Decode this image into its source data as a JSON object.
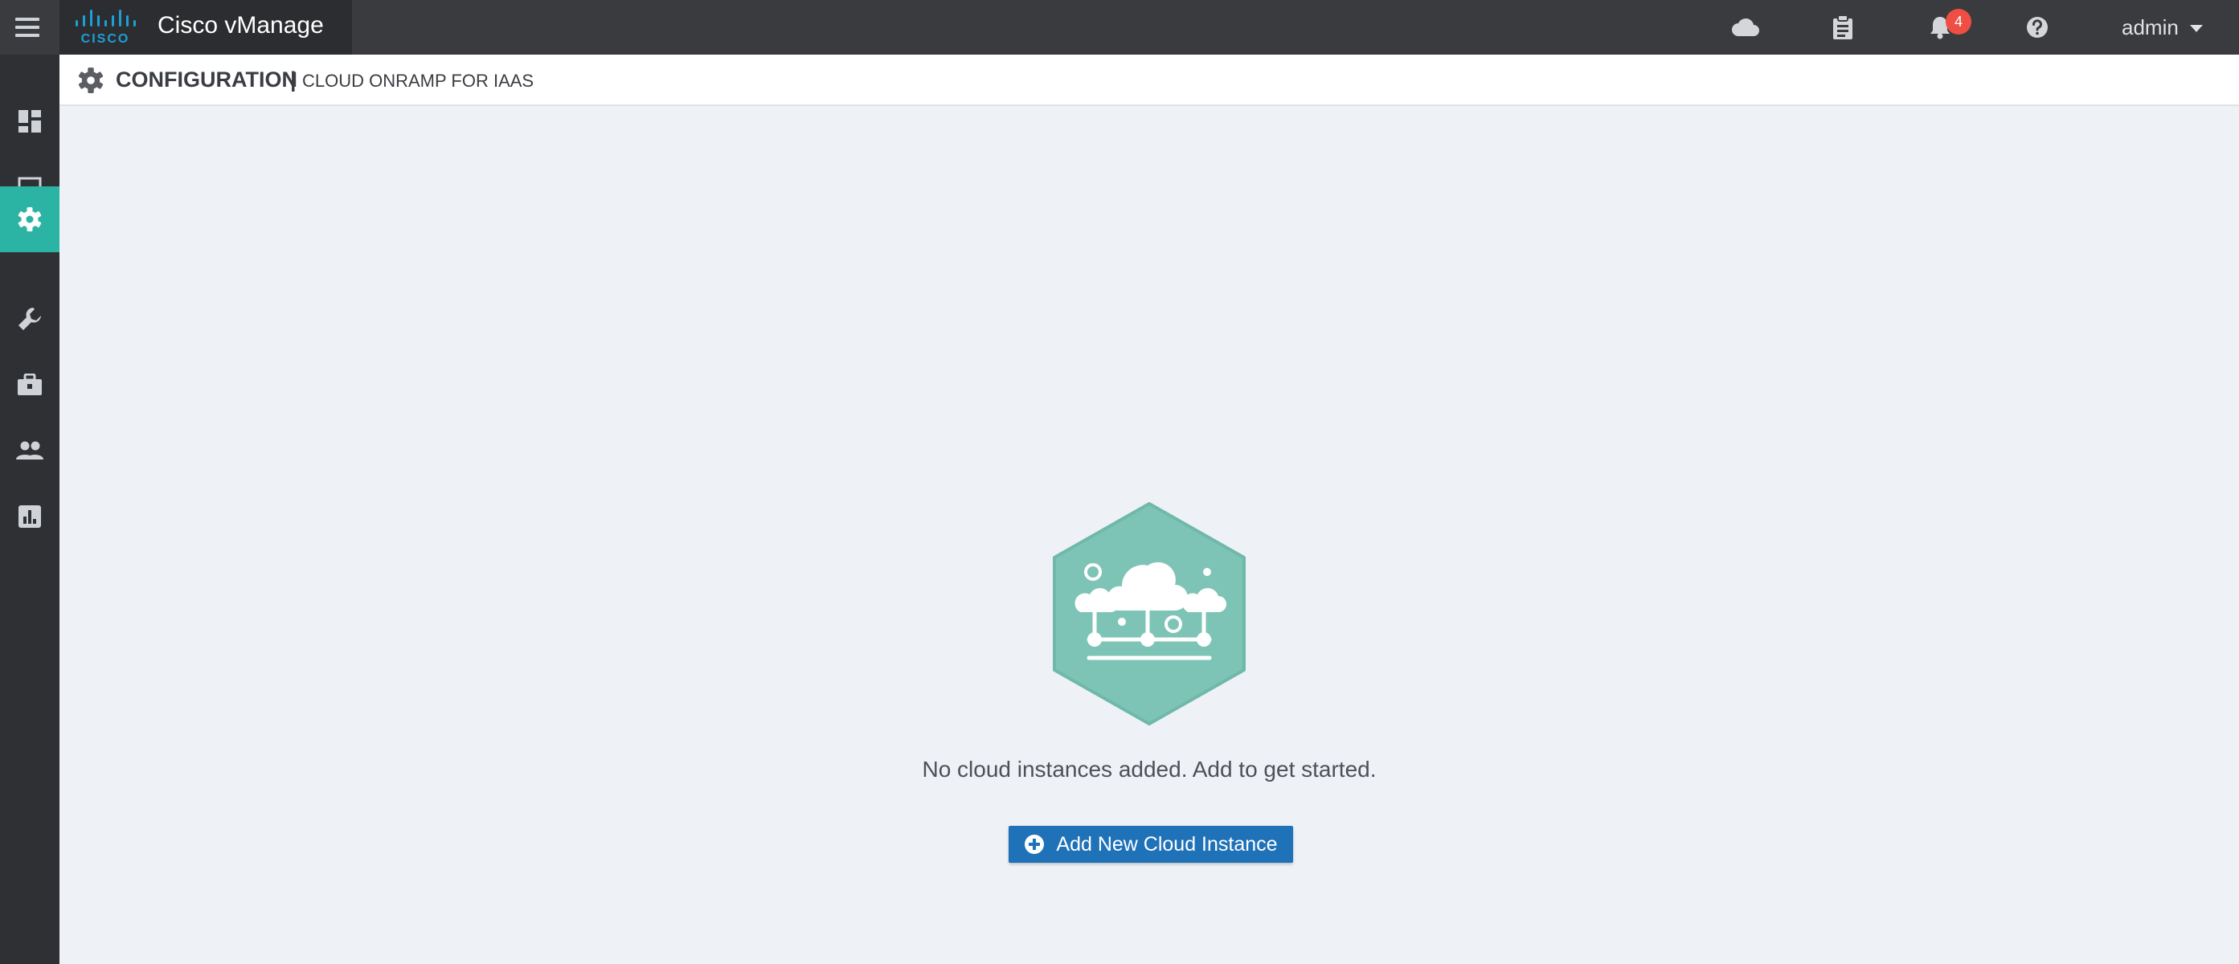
{
  "app": {
    "title": "Cisco vManage",
    "brand": "CISCO"
  },
  "topbar": {
    "icons": [
      "cloud-icon",
      "clipboard-icon",
      "bell-icon",
      "help-icon"
    ],
    "notification_count": "4",
    "user": "admin"
  },
  "sidebar": {
    "items": [
      {
        "name": "dashboard-icon"
      },
      {
        "name": "monitor-icon"
      },
      {
        "name": "configuration-gear-icon",
        "active": true
      },
      {
        "name": "tools-wrench-icon"
      },
      {
        "name": "maintenance-briefcase-icon"
      },
      {
        "name": "administration-users-icon"
      },
      {
        "name": "analytics-chart-icon"
      }
    ]
  },
  "header": {
    "section": "CONFIGURATION",
    "separator": "|",
    "subsection": "CLOUD ONRAMP FOR IAAS"
  },
  "empty_state": {
    "message": "No cloud instances added. Add to get started.",
    "button_label": "Add New Cloud Instance"
  },
  "colors": {
    "topbar": "#3a3b3e",
    "sidebar": "#2f3033",
    "active": "#2bb3a4",
    "accent_button": "#1f72b8",
    "illustration": "#7ec4b6",
    "badge": "#f04e44",
    "background": "#eef1f5"
  }
}
